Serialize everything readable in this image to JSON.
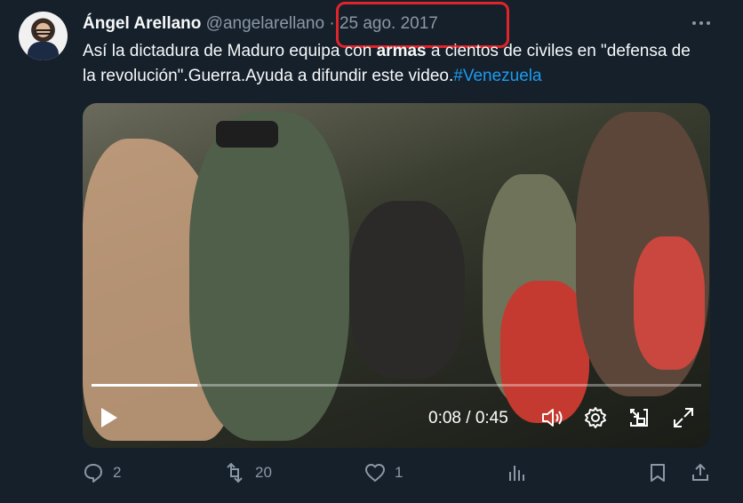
{
  "author": {
    "name": "Ángel Arellano",
    "handle": "@angelarellano",
    "separator": "·",
    "date": "25 ago. 2017"
  },
  "tweet": {
    "text_part1": "Así la dictadura de Maduro equipa con ",
    "text_bold": "armas",
    "text_part2": " a cientos de civiles en \"defensa de la revolución\".Guerra.Ayuda a difundir este video.",
    "hashtag": "#Venezuela"
  },
  "video": {
    "time_display": "0:08 / 0:45",
    "progress": 0.174
  },
  "actions": {
    "replies": "2",
    "retweets": "20",
    "likes": "1"
  },
  "icons": [
    "more-icon",
    "play-icon",
    "volume-icon",
    "settings-icon",
    "pip-icon",
    "fullscreen-icon",
    "reply-icon",
    "retweet-icon",
    "like-icon",
    "analytics-icon",
    "bookmark-icon",
    "share-icon"
  ],
  "colors": {
    "background": "#15202b",
    "text": "#f7f9f9",
    "muted": "#8b98a5",
    "link": "#1d9bf0",
    "annotation": "#e0242a"
  }
}
